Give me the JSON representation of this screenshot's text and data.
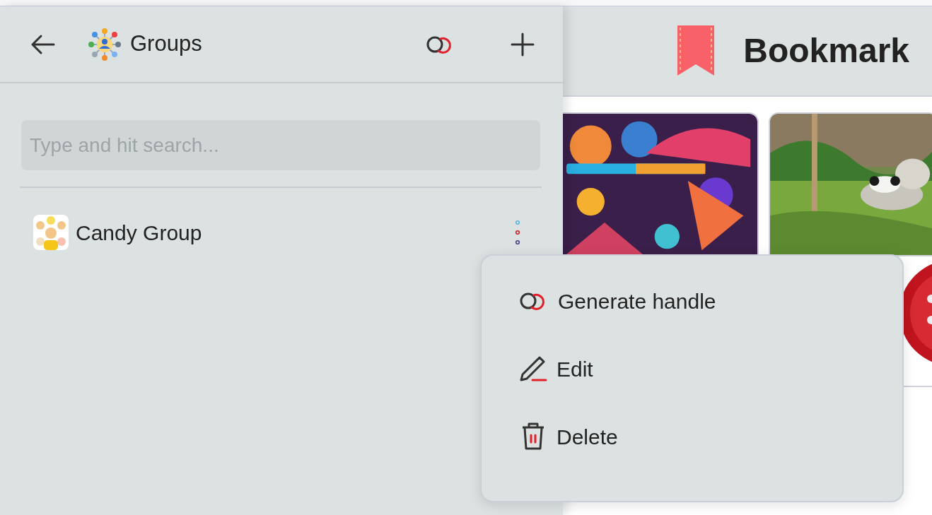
{
  "groups_panel": {
    "title": "Groups",
    "search": {
      "placeholder": "Type and hit search..."
    },
    "groups": [
      {
        "name": "Candy Group"
      }
    ]
  },
  "bookmark": {
    "title": "Bookmark"
  },
  "context_menu": [
    {
      "kind": "handle",
      "label": "Generate handle"
    },
    {
      "kind": "edit",
      "label": "Edit"
    },
    {
      "kind": "delete",
      "label": "Delete"
    }
  ]
}
